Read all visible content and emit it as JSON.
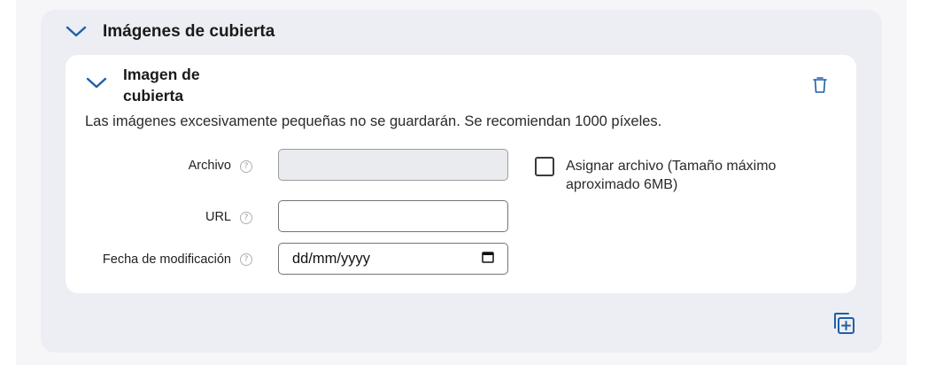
{
  "section": {
    "title": "Imágenes de cubierta"
  },
  "card": {
    "title": "Imagen de cubierta",
    "hint": "Las imágenes excesivamente pequeñas no se guardarán. Se recomiendan 1000 píxeles."
  },
  "fields": {
    "archivo": {
      "label": "Archivo",
      "value": ""
    },
    "url": {
      "label": "URL",
      "value": ""
    },
    "fecha": {
      "label": "Fecha de modificación",
      "placeholder": "dd/mm/yyyy"
    }
  },
  "assign": {
    "label": "Asignar archivo (Tamaño máximo aproximado 6MB)",
    "checked": false
  },
  "icons": {
    "help": "?",
    "chevron": "chevron-down-icon",
    "trash": "trash-icon",
    "calendar": "calendar-icon",
    "add": "add-copy-icon"
  },
  "colors": {
    "accent": "#1e5fa8",
    "section_bg": "#eceef3",
    "card_bg": "#ffffff"
  }
}
